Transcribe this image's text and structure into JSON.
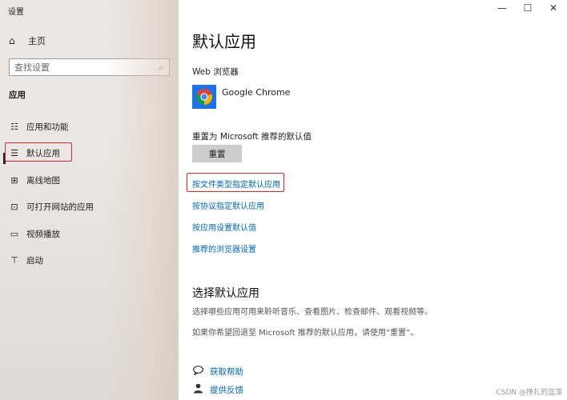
{
  "window": {
    "title": "设置",
    "minimize": "—",
    "maximize": "☐",
    "close": "✕"
  },
  "sidebar": {
    "home": {
      "icon": "home-icon",
      "glyph": "⌂",
      "label": "主页"
    },
    "search": {
      "placeholder": "查找设置",
      "icon": "search-icon",
      "glyph": "⌕"
    },
    "section": "应用",
    "items": [
      {
        "label": "应用和功能",
        "icon": "apps-features-icon",
        "glyph": "☷"
      },
      {
        "label": "默认应用",
        "icon": "default-apps-icon",
        "glyph": "☰",
        "selected": true
      },
      {
        "label": "离线地图",
        "icon": "offline-maps-icon",
        "glyph": "⊞"
      },
      {
        "label": "可打开网站的应用",
        "icon": "apps-for-websites-icon",
        "glyph": "⊡"
      },
      {
        "label": "视频播放",
        "icon": "video-playback-icon",
        "glyph": "▭"
      },
      {
        "label": "启动",
        "icon": "startup-icon",
        "glyph": "⊤"
      }
    ]
  },
  "main": {
    "title": "默认应用",
    "browser_label": "Web 浏览器",
    "browser_name": "Google Chrome",
    "reset_label": "重置为 Microsoft 推荐的默认值",
    "reset_button": "重置",
    "links": [
      "按文件类型指定默认应用",
      "按协议指定默认应用",
      "按应用设置默认值",
      "推荐的浏览器设置"
    ],
    "choose_title": "选择默认应用",
    "choose_desc1": "选择哪些应用可用来聆听音乐、查看图片、检查邮件、观看视频等。",
    "choose_desc2": "如果你希望回退至 Microsoft 推荐的默认应用，请使用“重置”。",
    "help_link": "获取帮助",
    "feedback_link": "提供反馈"
  },
  "watermark": "CSDN @挣扎的蓝藻",
  "colors": {
    "accent_link": "#0067b8",
    "highlight_box": "#e2272b",
    "button_bg": "#cccccc"
  }
}
